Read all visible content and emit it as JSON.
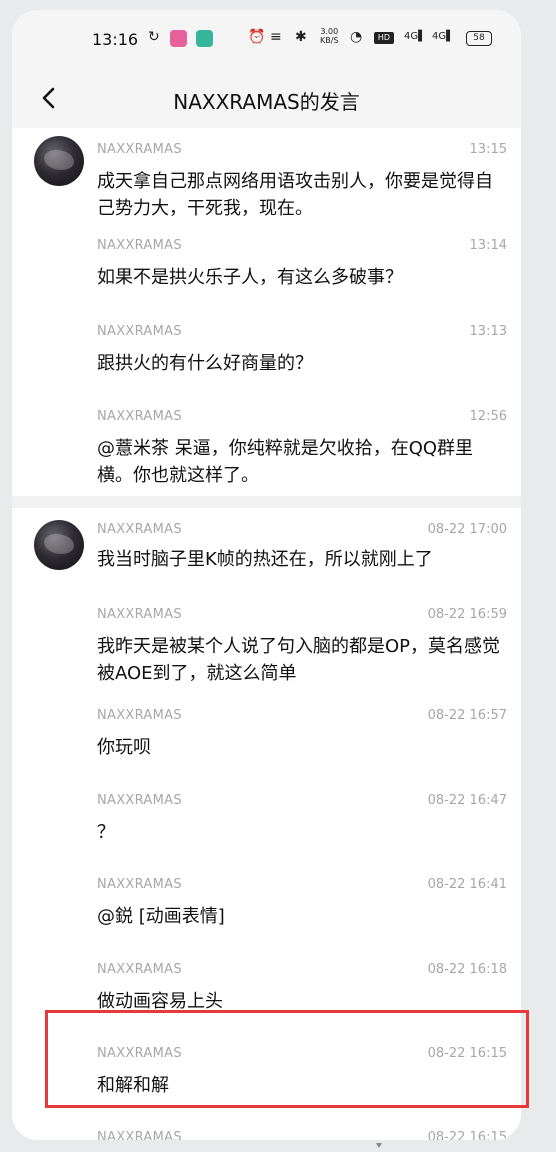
{
  "status_bar": {
    "time": "13:16",
    "net_speed_value": "3.00",
    "net_speed_unit": "KB/S",
    "hd_badge": "HD",
    "signal1": "4G",
    "signal2": "4G",
    "battery": "58"
  },
  "header": {
    "title": "NAXXRAMAS的发言"
  },
  "groups": [
    {
      "messages": [
        {
          "name": "NAXXRAMAS",
          "time": "13:15",
          "text": "成天拿自己那点网络用语攻击别人，你要是觉得自己势力大，干死我，现在。"
        },
        {
          "name": "NAXXRAMAS",
          "time": "13:14",
          "text": "如果不是拱火乐子人，有这么多破事？"
        },
        {
          "name": "NAXXRAMAS",
          "time": "13:13",
          "text": "跟拱火的有什么好商量的？"
        },
        {
          "name": "NAXXRAMAS",
          "time": "12:56",
          "text": "@薏米茶 呆逼，你纯粹就是欠收拾，在QQ群里横。你也就这样了。"
        }
      ]
    },
    {
      "messages": [
        {
          "name": "NAXXRAMAS",
          "time": "08-22 17:00",
          "text": "我当时脑子里K帧的热还在，所以就刚上了"
        },
        {
          "name": "NAXXRAMAS",
          "time": "08-22 16:59",
          "text": "我昨天是被某个人说了句入脑的都是OP，莫名感觉被AOE到了，就这么简单"
        },
        {
          "name": "NAXXRAMAS",
          "time": "08-22 16:57",
          "text": "你玩呗"
        },
        {
          "name": "NAXXRAMAS",
          "time": "08-22 16:47",
          "text": "？"
        },
        {
          "name": "NAXXRAMAS",
          "time": "08-22 16:41",
          "text": "@鋭 [动画表情]"
        },
        {
          "name": "NAXXRAMAS",
          "time": "08-22 16:18",
          "text": "做动画容易上头"
        },
        {
          "name": "NAXXRAMAS",
          "time": "08-22 16:15",
          "text": "和解和解"
        },
        {
          "name": "NAXXRAMAS",
          "time": "08-22 16:15",
          "text": ""
        }
      ]
    }
  ]
}
